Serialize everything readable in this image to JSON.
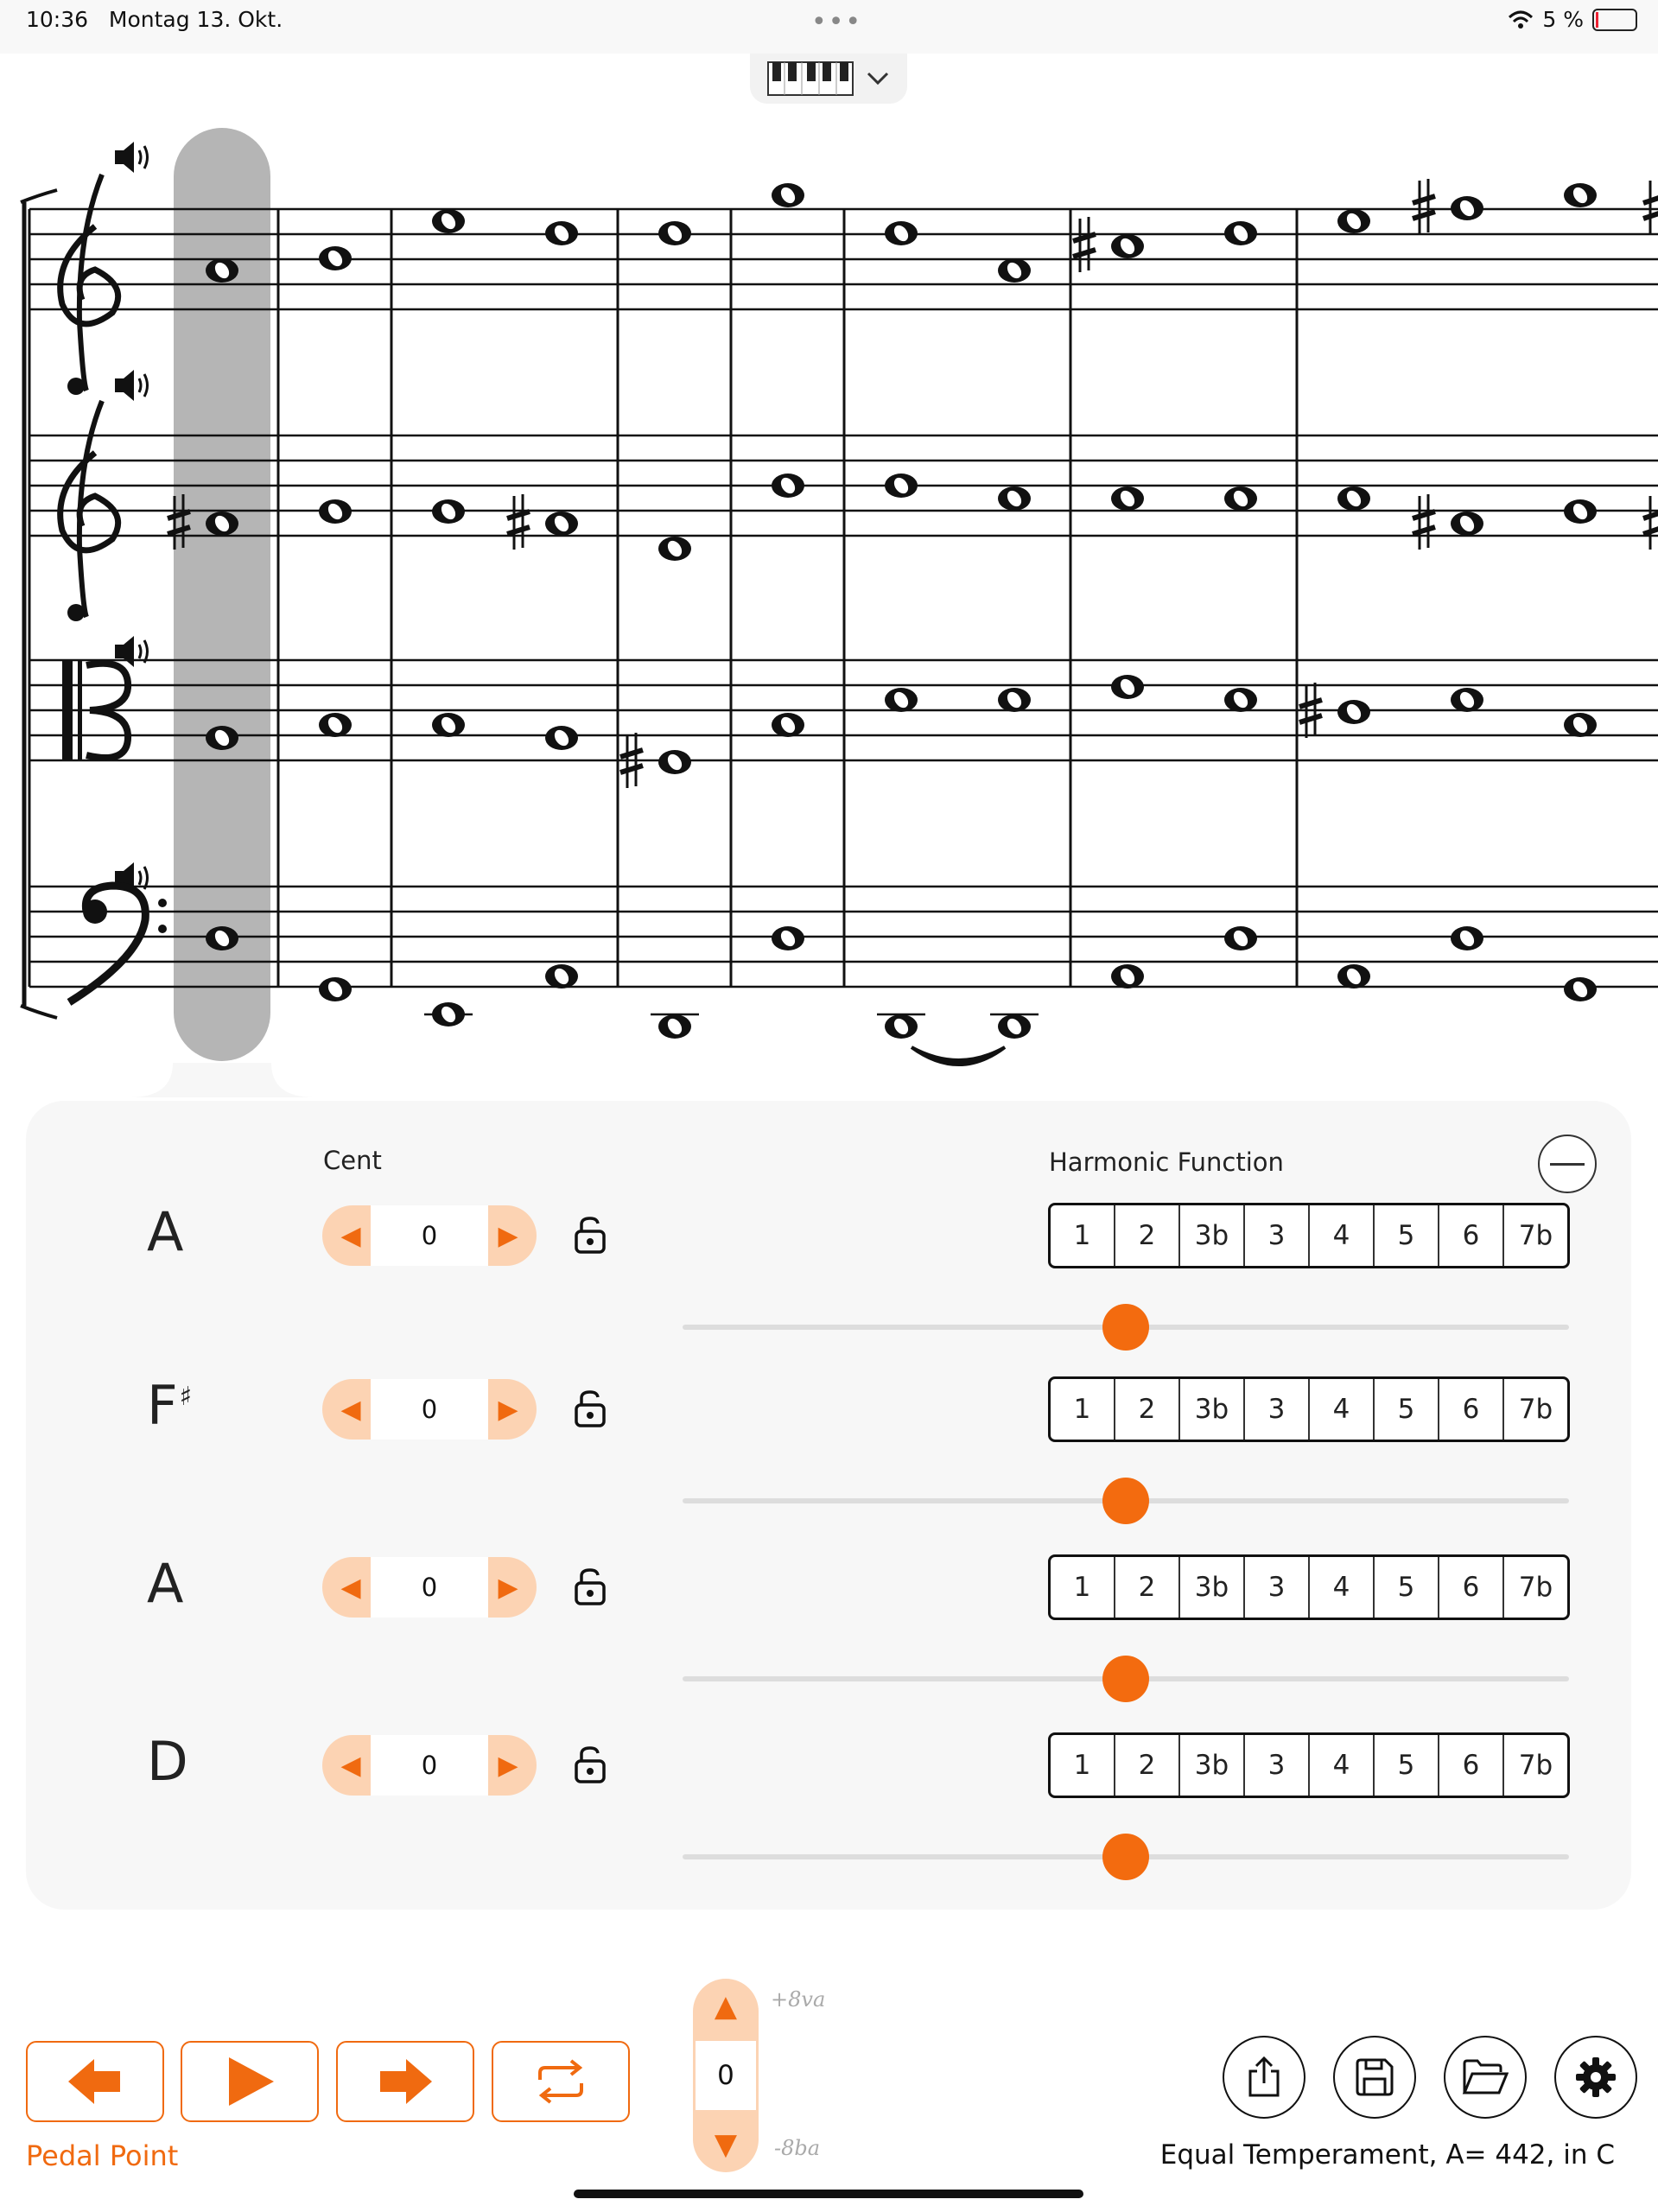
{
  "status_bar": {
    "time": "10:36",
    "date": "Montag 13. Okt.",
    "dots": "•••",
    "battery": "5 %"
  },
  "icons": {
    "wifi": "wifi-icon",
    "battery": "battery-icon",
    "keyboard": "piano-keyboard-icon",
    "chevron": "chevron-down-icon",
    "speaker": "speaker-icon",
    "lock": "unlock-icon",
    "share": "share-icon",
    "save": "save-icon",
    "open": "folder-open-icon",
    "settings": "gear-icon"
  },
  "colors": {
    "accent": "#f06a10",
    "accent_light": "#fcd3b3",
    "highlight": "#b3b3b3"
  },
  "panel": {
    "cent_label": "Cent",
    "harmonic_label": "Harmonic Function",
    "function_options": [
      "1",
      "2",
      "3b",
      "3",
      "4",
      "5",
      "6",
      "7b"
    ],
    "voices": [
      {
        "note": "A",
        "accidental": "",
        "cent": "0",
        "slider": 0.5
      },
      {
        "note": "F",
        "accidental": "♯",
        "cent": "0",
        "slider": 0.5
      },
      {
        "note": "A",
        "accidental": "",
        "cent": "0",
        "slider": 0.5
      },
      {
        "note": "D",
        "accidental": "",
        "cent": "0",
        "slider": 0.5
      }
    ]
  },
  "toolbar": {
    "pedal_point": "Pedal Point",
    "octave_value": "0",
    "octave_up_label": "+8va",
    "octave_down_label": "-8ba",
    "temperament": "Equal Temperament, A= 442, in C"
  }
}
